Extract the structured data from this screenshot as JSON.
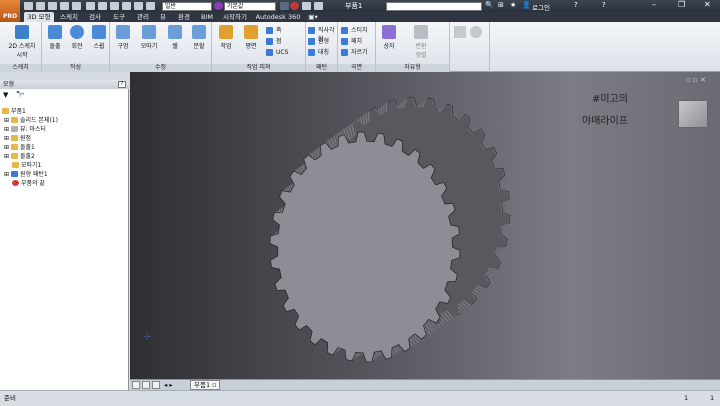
{
  "app_badge": "PRO",
  "qat": {
    "appearance_combo": "일반",
    "material_combo": "기본값",
    "doc_title": "부품1",
    "signin": "로그인"
  },
  "tabs": [
    "3D 모형",
    "스케치",
    "검사",
    "도구",
    "관리",
    "뷰",
    "환경",
    "BIM",
    "시작하기",
    "Autodesk 360"
  ],
  "ribbon": {
    "sketch": {
      "start": "2D 스케치\n시작",
      "group": "스케치"
    },
    "create": {
      "extrude": "돌출",
      "revolve": "회전",
      "sweep": "스윕",
      "group": "작성"
    },
    "modify": {
      "hole": "구멍",
      "fillet": "모따기",
      "shell": "쉘",
      "split": "분할",
      "group": "수정"
    },
    "work_features": {
      "plane": "작업",
      "axis": "평면",
      "point": "축",
      "ucs": "UCS",
      "group": "작업 피쳐"
    },
    "pattern": {
      "rect": "직사각형",
      "circ": "원형",
      "mirror": "대칭",
      "group": "패턴"
    },
    "surface": {
      "stitch": "스티치",
      "patch": "패치",
      "sculpt": "자르기",
      "group": "곡면"
    },
    "freeform": {
      "box": "상자",
      "convert": "변환\n정렬",
      "group": "자유형"
    }
  },
  "browser": {
    "header": "모형",
    "items": [
      "부품1",
      "솔리드 본체(1)",
      "뷰: 마스터",
      "원점",
      "돌출1",
      "돌출2",
      "모따기1",
      "원형 패턴1",
      "부품의 끝"
    ]
  },
  "viewport": {
    "watermark_line1": "#미고의",
    "watermark_line2": "야매라이프"
  },
  "doc_tabs": {
    "tab1": "부품1"
  },
  "status": {
    "left": "준비",
    "n1": "1",
    "n2": "1"
  }
}
